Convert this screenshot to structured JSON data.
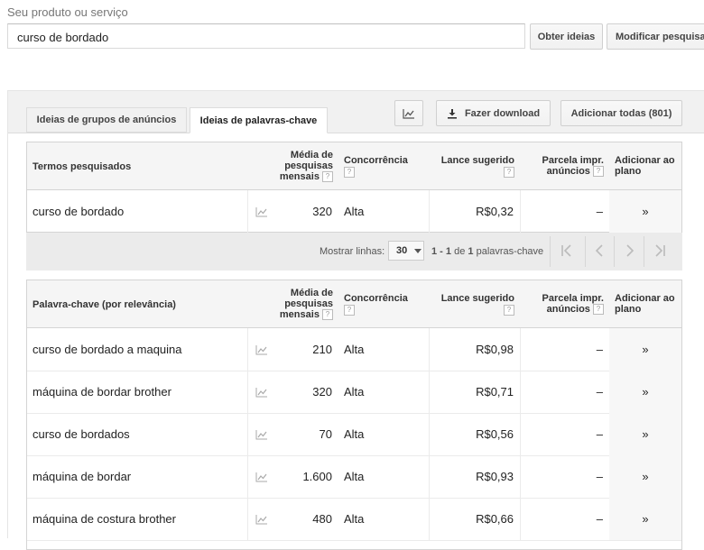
{
  "search": {
    "label": "Seu produto ou serviço",
    "value": "curso de bordado",
    "get_ideas_label": "Obter ideias",
    "modify_label": "Modificar pesquisa"
  },
  "tabs": [
    {
      "label": "Ideias de grupos de anúncios",
      "active": false
    },
    {
      "label": "Ideias de palavras-chave",
      "active": true
    }
  ],
  "toolbar": {
    "download_label": "Fazer download",
    "add_all_label": "Adicionar todas (801)"
  },
  "searched_table": {
    "headers": {
      "term": "Termos pesquisados",
      "avg_searches": [
        "Média de",
        "pesquisas",
        "mensais"
      ],
      "competition": "Concorrência",
      "bid": "Lance sugerido",
      "share": [
        "Parcela impr.",
        "anúncios"
      ],
      "add": [
        "Adicionar ao",
        "plano"
      ],
      "help": "?"
    },
    "rows": [
      {
        "keyword": "curso de bordado",
        "searches": "320",
        "competition": "Alta",
        "bid": "R$0,32",
        "share": "–",
        "add": "»"
      }
    ]
  },
  "pagination": {
    "show_rows_label": "Mostrar linhas:",
    "rows_value": "30",
    "range_prefix": "1 - 1",
    "range_of": "de",
    "range_total": "1",
    "range_suffix": "palavras-chave"
  },
  "keyword_table": {
    "headers": {
      "term": "Palavra-chave (por relevância)",
      "avg_searches": [
        "Média de",
        "pesquisas",
        "mensais"
      ],
      "competition": "Concorrência",
      "bid": "Lance sugerido",
      "share": [
        "Parcela impr.",
        "anúncios"
      ],
      "add": [
        "Adicionar ao",
        "plano"
      ],
      "help": "?"
    },
    "rows": [
      {
        "keyword": "curso de bordado a maquina",
        "searches": "210",
        "competition": "Alta",
        "bid": "R$0,98",
        "share": "–",
        "add": "»"
      },
      {
        "keyword": "máquina de bordar brother",
        "searches": "320",
        "competition": "Alta",
        "bid": "R$0,71",
        "share": "–",
        "add": "»"
      },
      {
        "keyword": "curso de bordados",
        "searches": "70",
        "competition": "Alta",
        "bid": "R$0,56",
        "share": "–",
        "add": "»"
      },
      {
        "keyword": "máquina de bordar",
        "searches": "1.600",
        "competition": "Alta",
        "bid": "R$0,93",
        "share": "–",
        "add": "»"
      },
      {
        "keyword": "máquina de costura brother",
        "searches": "480",
        "competition": "Alta",
        "bid": "R$0,66",
        "share": "–",
        "add": "»"
      }
    ]
  }
}
